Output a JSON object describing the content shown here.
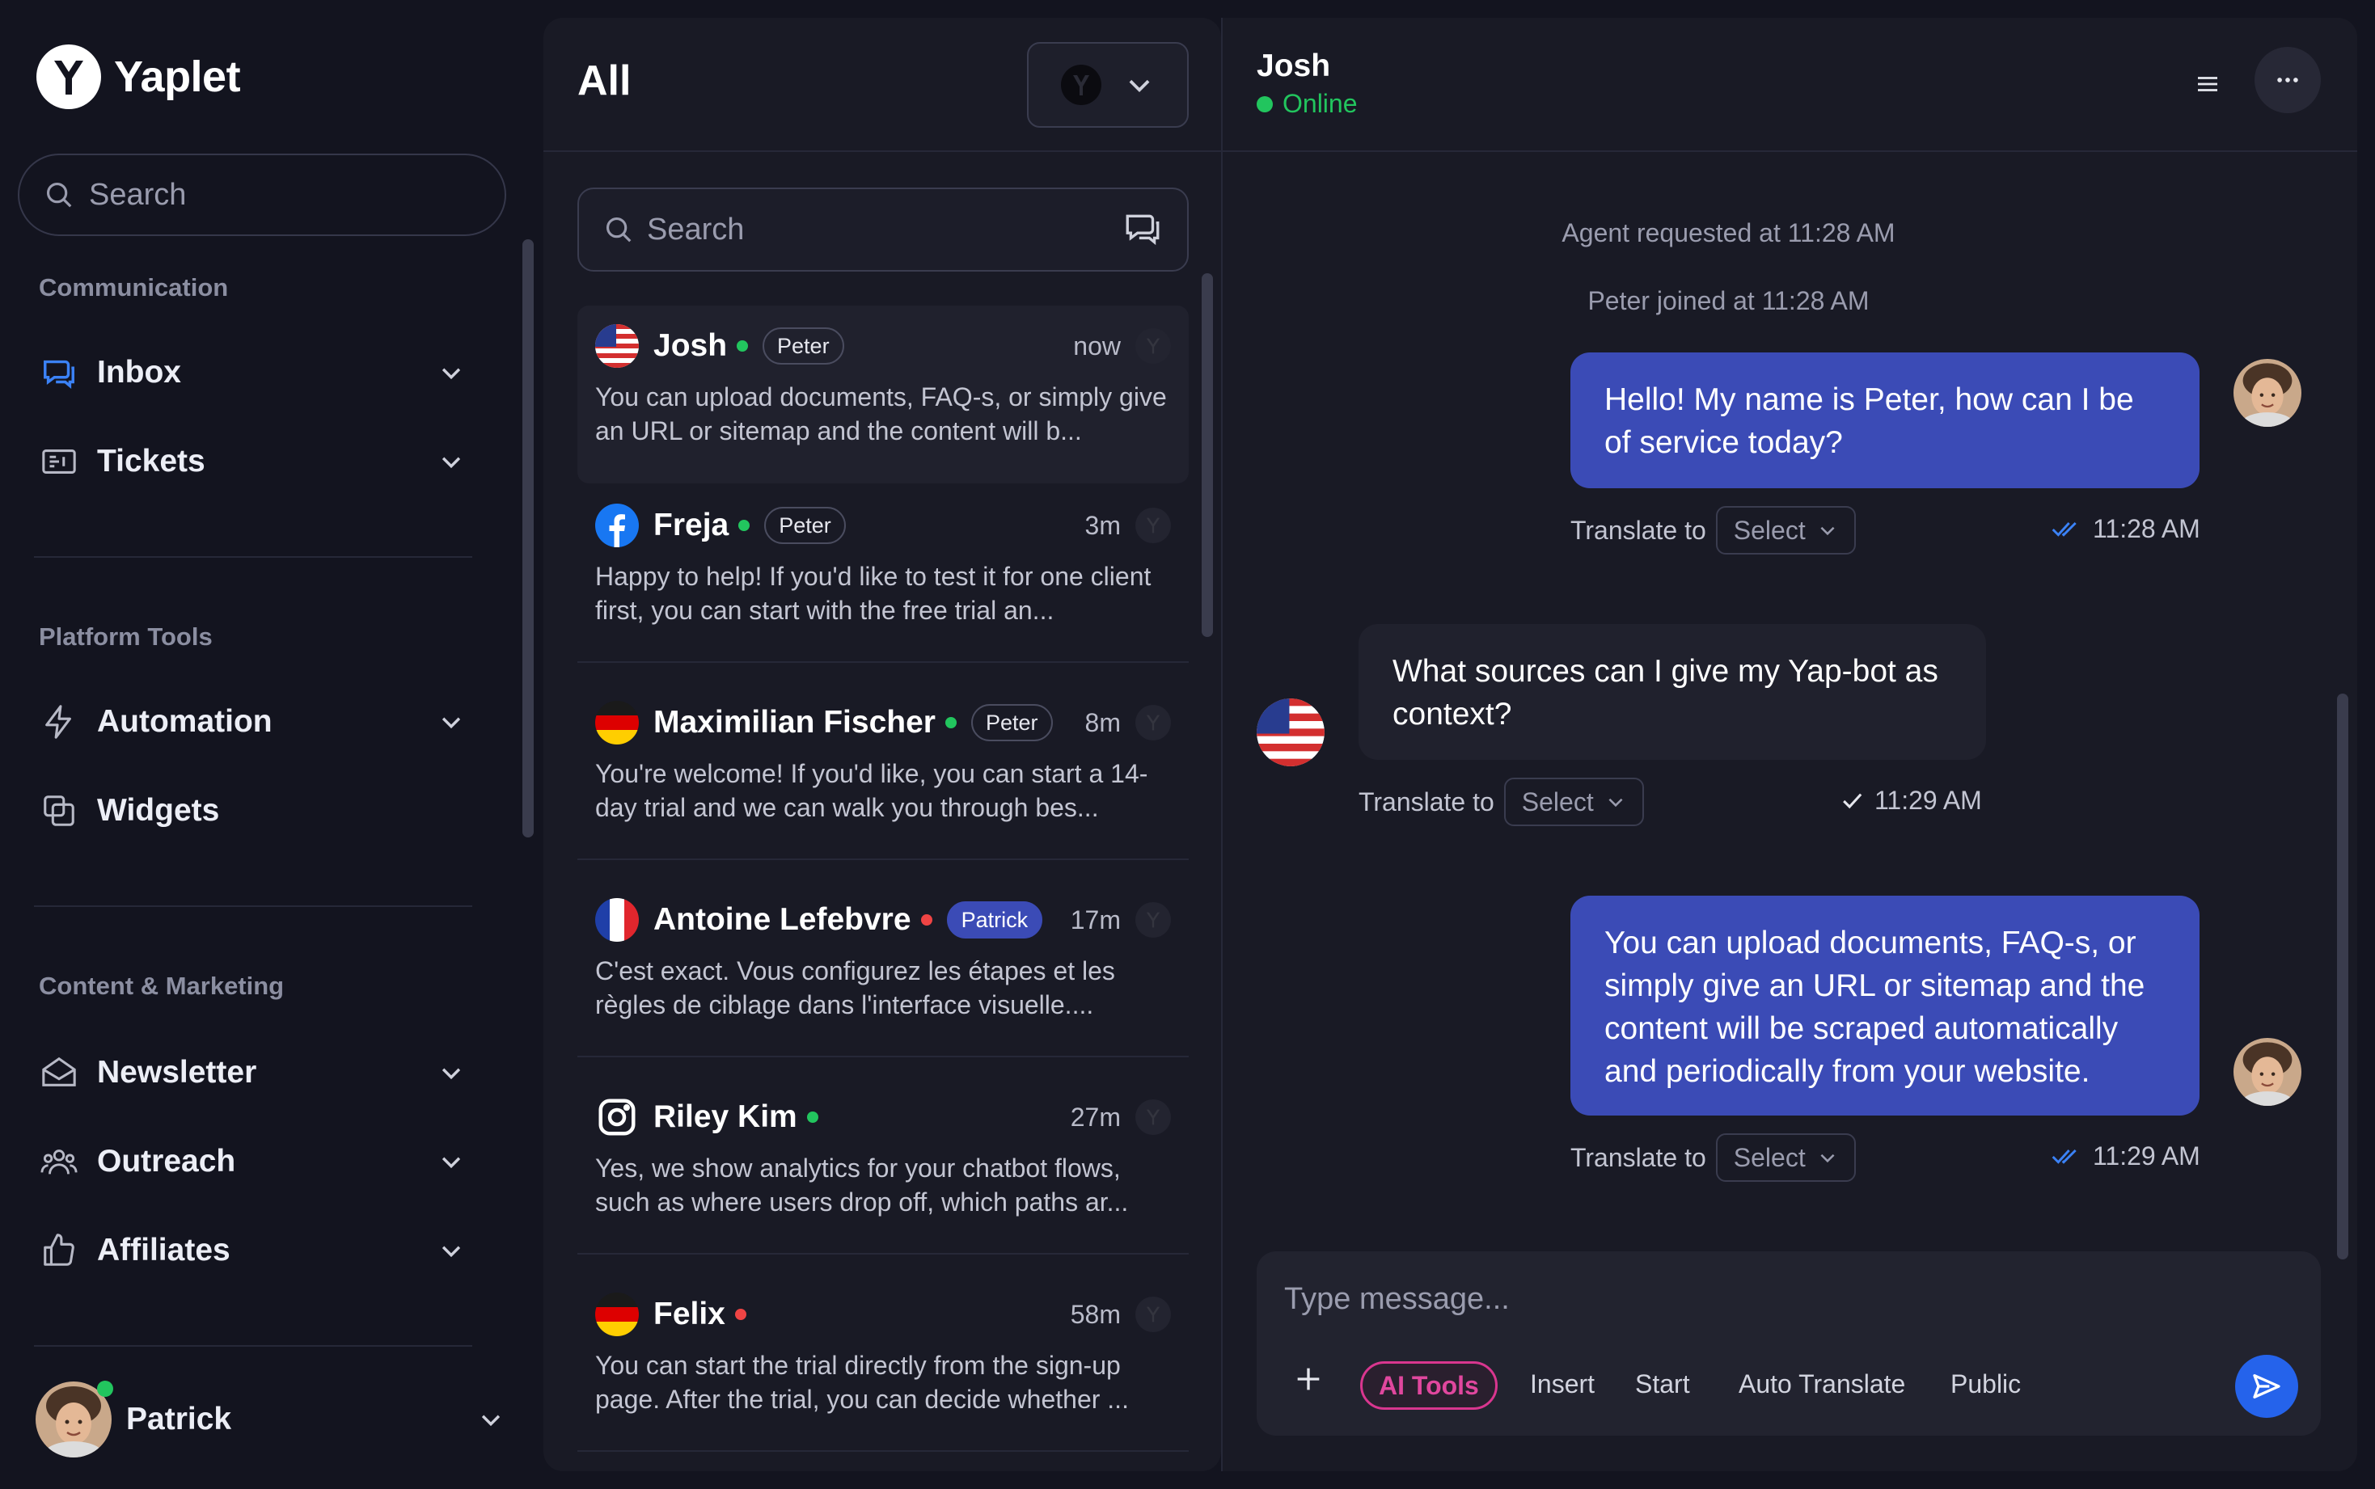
{
  "app": {
    "name": "Yaplet"
  },
  "sidebar": {
    "search_placeholder": "Search",
    "sections": [
      {
        "label": "Communication",
        "items": [
          {
            "label": "Inbox",
            "icon": "inbox-icon"
          },
          {
            "label": "Tickets",
            "icon": "ticket-icon"
          }
        ]
      },
      {
        "label": "Platform Tools",
        "items": [
          {
            "label": "Automation",
            "icon": "lightning-icon"
          },
          {
            "label": "Widgets",
            "icon": "widgets-icon"
          }
        ]
      },
      {
        "label": "Content & Marketing",
        "items": [
          {
            "label": "Newsletter",
            "icon": "envelope-icon"
          },
          {
            "label": "Outreach",
            "icon": "people-icon"
          },
          {
            "label": "Affiliates",
            "icon": "thumbs-up-icon"
          }
        ]
      }
    ],
    "user": {
      "name": "Patrick",
      "status": "online"
    }
  },
  "conversations": {
    "title": "All",
    "search_placeholder": "Search",
    "items": [
      {
        "name": "Josh",
        "flag": "us",
        "status": "online",
        "agent": "Peter",
        "time": "now",
        "preview": "You can upload documents, FAQ-s, or simply give an URL or sitemap and the content will b..."
      },
      {
        "name": "Freja",
        "flag": "facebook",
        "status": "online",
        "agent": "Peter",
        "time": "3m",
        "preview": "Happy to help! If you'd like to test it for one client first, you can start with the free trial an..."
      },
      {
        "name": "Maximilian Fischer",
        "flag": "de",
        "status": "online",
        "agent": "Peter",
        "time": "8m",
        "preview": "You're welcome! If you'd like, you can start a 14-day trial and we can walk you through bes..."
      },
      {
        "name": "Antoine Lefebvre",
        "flag": "fr",
        "status": "offline",
        "agent": "Patrick",
        "time": "17m",
        "preview": "C'est exact. Vous configurez les étapes et les règles de ciblage dans l'interface visuelle...."
      },
      {
        "name": "Riley Kim",
        "flag": "instagram",
        "status": "online",
        "agent": "",
        "time": "27m",
        "preview": "Yes, we show analytics for your chatbot flows, such as where users drop off, which paths ar..."
      },
      {
        "name": "Felix",
        "flag": "de",
        "status": "offline",
        "agent": "",
        "time": "58m",
        "preview": "You can start the trial directly from the sign-up page. After the trial, you can decide whether ..."
      }
    ]
  },
  "chat": {
    "contact_name": "Josh",
    "contact_status": "Online",
    "system_messages": [
      "Agent requested at 11:28 AM",
      "Peter joined at 11:28 AM"
    ],
    "messages": [
      {
        "direction": "out",
        "lines": [
          "Hello! My name is Peter, how can I be",
          "of service today?"
        ],
        "translate_label": "Translate to",
        "select_label": "Select",
        "time": "11:28 AM",
        "receipt": "read"
      },
      {
        "direction": "in",
        "lines": [
          "What sources can I give my Yap-bot as",
          "context?"
        ],
        "translate_label": "Translate to",
        "select_label": "Select",
        "time": "11:29 AM",
        "receipt": "sent"
      },
      {
        "direction": "out",
        "lines": [
          "You can upload documents, FAQ-s, or",
          "simply give an URL or sitemap and the",
          "content will be scraped automatically",
          "and periodically from your website."
        ],
        "translate_label": "Translate to",
        "select_label": "Select",
        "time": "11:29 AM",
        "receipt": "read"
      }
    ],
    "composer": {
      "placeholder": "Type message...",
      "ai_tools": "AI Tools",
      "options": [
        "Insert",
        "Start",
        "Auto Translate",
        "Public"
      ]
    }
  },
  "colors": {
    "accent": "#3b4bb6",
    "online": "#22c55e",
    "offline": "#ef4444",
    "ai": "#e0479e",
    "send": "#2563eb"
  }
}
